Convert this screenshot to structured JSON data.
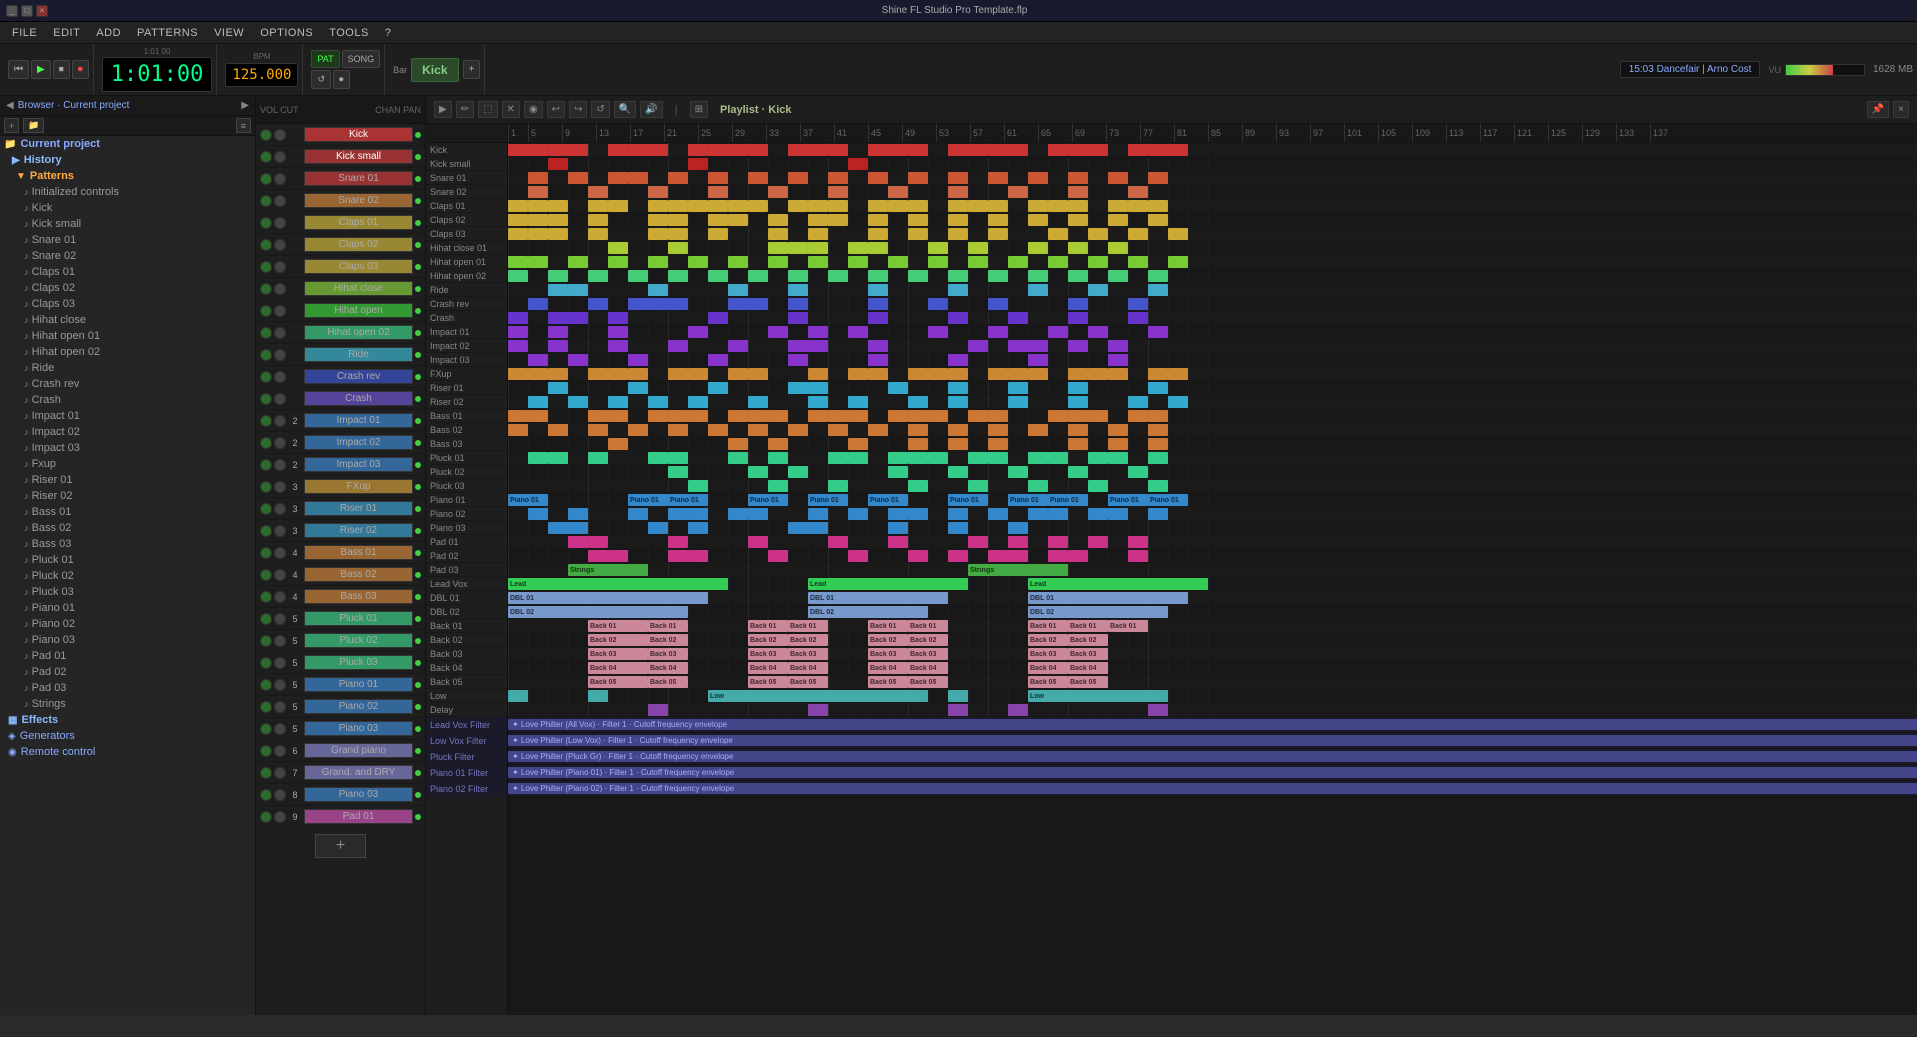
{
  "titleBar": {
    "title": "Shine FL Studio Pro Template.flp",
    "controls": [
      "_",
      "□",
      "×"
    ]
  },
  "menuBar": {
    "items": [
      "FILE",
      "EDIT",
      "ADD",
      "PATTERNS",
      "VIEW",
      "OPTIONS",
      "TOOLS",
      "?"
    ]
  },
  "transport": {
    "time": "1:01:00",
    "bpm": "125.000",
    "instrument": "Kick",
    "barLabel": "Bar",
    "timeInfo": "1:01  00",
    "songInfo": "15:03  Dancefair | Arno Cost",
    "vu": "64",
    "mem": "1628 MB"
  },
  "browser": {
    "header": "Browser · Current project",
    "sections": [
      {
        "type": "section",
        "label": "History",
        "icon": "▶"
      },
      {
        "type": "subsection",
        "label": "Patterns",
        "icon": "♪",
        "expanded": true
      },
      {
        "type": "leaf",
        "label": "Initialized controls",
        "icon": "♪"
      },
      {
        "type": "leaf",
        "label": "Kick",
        "icon": "♪"
      },
      {
        "type": "leaf",
        "label": "Kick small",
        "icon": "♪"
      },
      {
        "type": "leaf",
        "label": "Snare 01",
        "icon": "♪"
      },
      {
        "type": "leaf",
        "label": "Snare 02",
        "icon": "♪"
      },
      {
        "type": "leaf",
        "label": "Claps 01",
        "icon": "♪"
      },
      {
        "type": "leaf",
        "label": "Claps 02",
        "icon": "♪"
      },
      {
        "type": "leaf",
        "label": "Claps 03",
        "icon": "♪"
      },
      {
        "type": "leaf",
        "label": "Hihat close",
        "icon": "♪"
      },
      {
        "type": "leaf",
        "label": "Hihat open 01",
        "icon": "♪"
      },
      {
        "type": "leaf",
        "label": "Hihat open 02",
        "icon": "♪"
      },
      {
        "type": "leaf",
        "label": "Ride",
        "icon": "♪"
      },
      {
        "type": "leaf",
        "label": "Crash rev",
        "icon": "♪"
      },
      {
        "type": "leaf",
        "label": "Crash",
        "icon": "♪"
      },
      {
        "type": "leaf",
        "label": "Impact 01",
        "icon": "♪"
      },
      {
        "type": "leaf",
        "label": "Impact 02",
        "icon": "♪"
      },
      {
        "type": "leaf",
        "label": "Impact 03",
        "icon": "♪"
      },
      {
        "type": "leaf",
        "label": "Fxup",
        "icon": "♪"
      },
      {
        "type": "leaf",
        "label": "Riser 01",
        "icon": "♪"
      },
      {
        "type": "leaf",
        "label": "Riser 02",
        "icon": "♪"
      },
      {
        "type": "leaf",
        "label": "Bass 01",
        "icon": "♪"
      },
      {
        "type": "leaf",
        "label": "Bass 02",
        "icon": "♪"
      },
      {
        "type": "leaf",
        "label": "Bass 03",
        "icon": "♪"
      },
      {
        "type": "leaf",
        "label": "Pluck 01",
        "icon": "♪"
      },
      {
        "type": "leaf",
        "label": "Pluck 02",
        "icon": "♪"
      },
      {
        "type": "leaf",
        "label": "Pluck 03",
        "icon": "♪"
      },
      {
        "type": "leaf",
        "label": "Piano 01",
        "icon": "♪"
      },
      {
        "type": "leaf",
        "label": "Piano 02",
        "icon": "♪"
      },
      {
        "type": "leaf",
        "label": "Piano 03",
        "icon": "♪"
      },
      {
        "type": "leaf",
        "label": "Pad 01",
        "icon": "♪"
      },
      {
        "type": "leaf",
        "label": "Pad 02",
        "icon": "♪"
      },
      {
        "type": "leaf",
        "label": "Pad 03",
        "icon": "♪"
      },
      {
        "type": "leaf",
        "label": "Strings",
        "icon": "♪"
      },
      {
        "type": "section",
        "label": "Effects",
        "icon": "▦"
      },
      {
        "type": "section",
        "label": "Generators",
        "icon": "◈"
      },
      {
        "type": "section",
        "label": "Remote control",
        "icon": "◉"
      }
    ]
  },
  "channels": [
    {
      "num": "",
      "name": "Kick",
      "color": "#cc4444",
      "dot": "green"
    },
    {
      "num": "",
      "name": "Kick small",
      "color": "#cc4444",
      "dot": "green"
    },
    {
      "num": "",
      "name": "Snare 01",
      "color": "#cc4444",
      "dot": "green"
    },
    {
      "num": "",
      "name": "Snare 02",
      "color": "#cc6644",
      "dot": "green"
    },
    {
      "num": "",
      "name": "Claps 01",
      "color": "#ccaa44",
      "dot": "green"
    },
    {
      "num": "",
      "name": "Claps 02",
      "color": "#ccaa44",
      "dot": "green"
    },
    {
      "num": "",
      "name": "Claps 03",
      "color": "#ccaa44",
      "dot": "green"
    },
    {
      "num": "",
      "name": "Hihat close",
      "color": "#aacc44",
      "dot": "green"
    },
    {
      "num": "",
      "name": "Hihat open 01",
      "color": "#44cc44",
      "dot": "green"
    },
    {
      "num": "",
      "name": "Hihat open 02",
      "color": "#44ccaa",
      "dot": "green"
    },
    {
      "num": "",
      "name": "Ride",
      "color": "#44aacc",
      "dot": "green"
    },
    {
      "num": "",
      "name": "Crash rev",
      "color": "#4466cc",
      "dot": "green"
    },
    {
      "num": "",
      "name": "Crash",
      "color": "#6644cc",
      "dot": "green"
    },
    {
      "num": "2",
      "name": "Impact 01",
      "color": "#aa44cc",
      "dot": "green"
    },
    {
      "num": "2",
      "name": "Impact 02",
      "color": "#cc44aa",
      "dot": "green"
    },
    {
      "num": "2",
      "name": "Impact 03",
      "color": "#cc4466",
      "dot": "green"
    },
    {
      "num": "3",
      "name": "FXup",
      "color": "#cc6644",
      "dot": "green"
    },
    {
      "num": "3",
      "name": "Riser 01",
      "color": "#44aacc",
      "dot": "green"
    },
    {
      "num": "3",
      "name": "Riser 02",
      "color": "#44aacc",
      "dot": "green"
    },
    {
      "num": "4",
      "name": "Bass 01",
      "color": "#cc8844",
      "dot": "green"
    },
    {
      "num": "4",
      "name": "Bass 02",
      "color": "#cc8844",
      "dot": "green"
    },
    {
      "num": "4",
      "name": "Bass 03",
      "color": "#cc8844",
      "dot": "green"
    },
    {
      "num": "5",
      "name": "Pluck 01",
      "color": "#44cc88",
      "dot": "green"
    },
    {
      "num": "5",
      "name": "Pluck 02",
      "color": "#44cc88",
      "dot": "green"
    },
    {
      "num": "5",
      "name": "Pluck 03",
      "color": "#44cc88",
      "dot": "green"
    },
    {
      "num": "5",
      "name": "Piano 01",
      "color": "#4488cc",
      "dot": "green"
    },
    {
      "num": "5",
      "name": "Piano 02",
      "color": "#4488cc",
      "dot": "green"
    },
    {
      "num": "5",
      "name": "Piano 03",
      "color": "#4488cc",
      "dot": "green"
    },
    {
      "num": "6",
      "name": "Grand piano",
      "color": "#8844cc",
      "dot": "green"
    },
    {
      "num": "7",
      "name": "Grand. and DRY",
      "color": "#8844cc",
      "dot": "green"
    },
    {
      "num": "8",
      "name": "Piano 03",
      "color": "#4488cc",
      "dot": "green"
    },
    {
      "num": "9",
      "name": "Pad 01",
      "color": "#cc4488",
      "dot": "green"
    }
  ],
  "playlist": {
    "title": "Playlist · Kick",
    "tracks": [
      "Kick",
      "Kick small",
      "Snare 01",
      "Snare 02",
      "Claps 01",
      "Claps 02",
      "Claps 03",
      "Hihat close 01",
      "Hihat open 01",
      "Hihat open 02",
      "Ride",
      "Crash rev",
      "Crash",
      "Impact 01",
      "Impact 02",
      "Impact 03",
      "FXup",
      "Riser 01",
      "Riser 02",
      "Bass 01",
      "Bass 02",
      "Bass 03",
      "Pluck 01",
      "Pluck 02",
      "Pluck 03",
      "Piano 01",
      "Piano 02",
      "Piano 03",
      "Pad 01",
      "Pad 02",
      "Pad 03",
      "Lead Vox",
      "DBL 01",
      "DBL 02",
      "Back 01",
      "Back 02",
      "Back 03",
      "Back 04",
      "Back 05",
      "Low",
      "Delay"
    ],
    "filterTracks": [
      "Lead Vox Filter",
      "Low Vox Filter",
      "Pluck Filter",
      "Piano 01 Filter",
      "Piano 02 Filter"
    ],
    "filterLabels": [
      "Love Philter (All Vox) · Filter 1 · Cutoff frequency envelope",
      "Love Philter (Low Vox) · Filter 1 · Cutoff frequency envelope",
      "Love Philter (Pluck Gr) · Filter 1 · Cutoff frequency envelope",
      "Love Philter (Piano 01) · Filter 1 · Cutoff frequency envelope",
      "Love Philter (Piano 02) · Filter 1 · Cutoff frequency envelope"
    ],
    "rulerMarkers": [
      "1",
      "5",
      "9",
      "13",
      "17",
      "21",
      "25",
      "29",
      "33",
      "37",
      "41",
      "45",
      "49",
      "53",
      "57",
      "61",
      "65",
      "69",
      "73",
      "77",
      "81",
      "85",
      "89",
      "93",
      "97",
      "101",
      "105",
      "109",
      "113",
      "117",
      "121",
      "125",
      "129",
      "133",
      "137"
    ]
  },
  "colors": {
    "kick": "#cc3333",
    "kickSmall": "#cc3333",
    "snare": "#cc6633",
    "claps": "#ccaa33",
    "hihat": "#aacc33",
    "ride": "#44aacc",
    "crash": "#6633cc",
    "impact": "#aa33cc",
    "fxup": "#cc8833",
    "riser": "#33aacc",
    "bass": "#cc7733",
    "pluck": "#33cc88",
    "piano": "#3388cc",
    "pad": "#cc3388",
    "strings": "#44aa44",
    "leadVox": "#33cc66",
    "dbl": "#88aacc",
    "back": "#cc88aa",
    "low": "#44aaaa",
    "delay": "#8844aa",
    "filterBar": "#5555aa"
  }
}
